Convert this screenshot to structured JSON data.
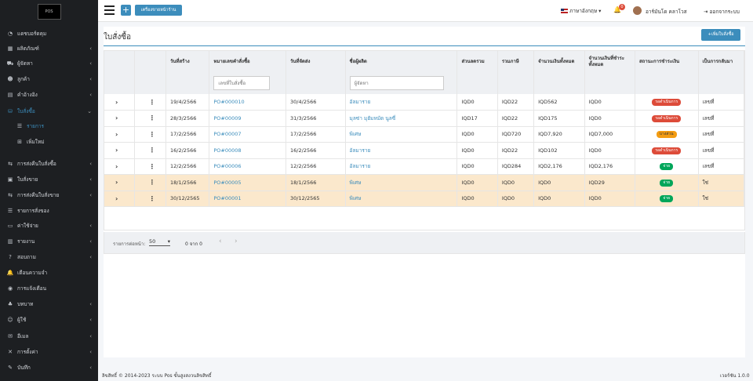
{
  "sidebar": {
    "logo_text": "POS",
    "items": [
      {
        "label": "แดชบอร์ดคุม",
        "icon": "dashboard-icon",
        "chev": false
      },
      {
        "label": "ผลิตภัณฑ์",
        "icon": "box-icon",
        "chev": true
      },
      {
        "label": "ผู้จัดหา",
        "icon": "truck-icon",
        "chev": true
      },
      {
        "label": "ลูกค้า",
        "icon": "users-icon",
        "chev": true
      },
      {
        "label": "คำอ้างอิง",
        "icon": "quote-icon",
        "chev": true
      },
      {
        "label": "ใบสั่งซื้อ",
        "icon": "cart-icon",
        "chev": true
      },
      {
        "label": "รายการ",
        "icon": "list-icon",
        "chev": false
      },
      {
        "label": "เพิ่มใหม่",
        "icon": "plus-square-icon",
        "chev": false
      },
      {
        "label": "การส่งคืนใบสั่งซื้อ",
        "icon": "return-icon",
        "chev": true
      },
      {
        "label": "ใบสั่งขาย",
        "icon": "invoice-icon",
        "chev": true
      },
      {
        "label": "การส่งคืนใบสั่งขาย",
        "icon": "return-icon",
        "chev": true
      },
      {
        "label": "รายการสั่งของ",
        "icon": "list-icon",
        "chev": false
      },
      {
        "label": "ค่าใช้จ่าย",
        "icon": "wallet-icon",
        "chev": true
      },
      {
        "label": "รายงาน",
        "icon": "chart-icon",
        "chev": true
      },
      {
        "label": "สอบถาม",
        "icon": "question-icon",
        "chev": true
      },
      {
        "label": "เตือนความจำ",
        "icon": "bell-icon",
        "chev": false
      },
      {
        "label": "การแจ้งเตือน",
        "icon": "alert-icon",
        "chev": false
      },
      {
        "label": "บทบาท",
        "icon": "role-icon",
        "chev": true
      },
      {
        "label": "ผู้ใช้",
        "icon": "user-icon",
        "chev": true
      },
      {
        "label": "อีเมล",
        "icon": "mail-icon",
        "chev": true
      },
      {
        "label": "การตั้งค่า",
        "icon": "tools-icon",
        "chev": true
      },
      {
        "label": "บันทึก",
        "icon": "log-icon",
        "chev": true
      }
    ]
  },
  "topbar": {
    "pos_label": "เครื่องขายหน้าร้าน",
    "language": "ภาษาอังกฤษ",
    "notif_count": "0",
    "user_name": "อาร์มันโด คลาโวส",
    "logout": "ออกจากระบบ"
  },
  "page": {
    "title": "ใบสั่งซื้อ",
    "add_button": "+เพิ่มใบสั่งซื้อ",
    "headers": [
      "วันที่สร้าง",
      "หมายเลขคำสั่งซื้อ",
      "วันที่จัดส่ง",
      "ชื่อผู้ผลิต",
      "ส่วนลดรวม",
      "รวมภาษี",
      "จำนวนเงินทั้งหมด",
      "จำนวนเงินที่ชำระทั้งหมด",
      "สถานะการชำระเงิน",
      "เป็นการกลับมา"
    ],
    "filter_po_placeholder": "เลขที่ใบสั่งซื้อ",
    "filter_supplier_placeholder": "ผู้จัดหา",
    "rows": [
      {
        "created": "19/4/2566",
        "po": "PO#000010",
        "delivery": "30/4/2566",
        "supplier": "อัลมาราย",
        "discount": "IQD0",
        "tax": "IQD22",
        "total": "IQD562",
        "paid": "IQD0",
        "status": "รอดำเนินการ",
        "status_type": "red",
        "returned": "เลขที่",
        "hl": false
      },
      {
        "created": "28/3/2566",
        "po": "PO#00009",
        "delivery": "31/3/2566",
        "supplier": "มุลซ่า มุฮัมหมัด นูลซี่",
        "discount": "IQD17",
        "tax": "IQD22",
        "total": "IQD175",
        "paid": "IQD0",
        "status": "รอดำเนินการ",
        "status_type": "red",
        "returned": "เลขที่",
        "hl": false
      },
      {
        "created": "17/2/2566",
        "po": "PO#00007",
        "delivery": "17/2/2566",
        "supplier": "พิเศษ",
        "discount": "IQD0",
        "tax": "IQD720",
        "total": "IQD7,920",
        "paid": "IQD7,000",
        "status": "บางส่วน",
        "status_type": "yellow",
        "returned": "เลขที่",
        "hl": false
      },
      {
        "created": "16/2/2566",
        "po": "PO#00008",
        "delivery": "16/2/2566",
        "supplier": "อัลมาราย",
        "discount": "IQD0",
        "tax": "IQD22",
        "total": "IQD102",
        "paid": "IQD0",
        "status": "รอดำเนินการ",
        "status_type": "red",
        "returned": "เลขที่",
        "hl": false
      },
      {
        "created": "12/2/2566",
        "po": "PO#00006",
        "delivery": "12/2/2566",
        "supplier": "อัลมาราย",
        "discount": "IQD0",
        "tax": "IQD284",
        "total": "IQD2,176",
        "paid": "IQD2,176",
        "status": "จ่าย",
        "status_type": "green",
        "returned": "เลขที่",
        "hl": false
      },
      {
        "created": "18/1/2566",
        "po": "PO#00005",
        "delivery": "18/1/2566",
        "supplier": "พิเศษ",
        "discount": "IQD0",
        "tax": "IQD0",
        "total": "IQD0",
        "paid": "IQD29",
        "status": "จ่าย",
        "status_type": "green",
        "returned": "ใช่",
        "hl": true
      },
      {
        "created": "30/12/2565",
        "po": "PO#00001",
        "delivery": "30/12/2565",
        "supplier": "พิเศษ",
        "discount": "IQD0",
        "tax": "IQD0",
        "total": "IQD0",
        "paid": "IQD0",
        "status": "จ่าย",
        "status_type": "green",
        "returned": "ใช่",
        "hl": true
      }
    ],
    "pager": {
      "label": "รายการต่อหน้า:",
      "per_page": "50",
      "count": "0 จาก 0"
    }
  },
  "footer": {
    "copyright": "ลิขสิทธิ์ © 2014-2023 ระบบ Pos ขั้นสูงสงวนลิขสิทธิ์",
    "version": "เวอร์ชัน 1.0.0"
  }
}
